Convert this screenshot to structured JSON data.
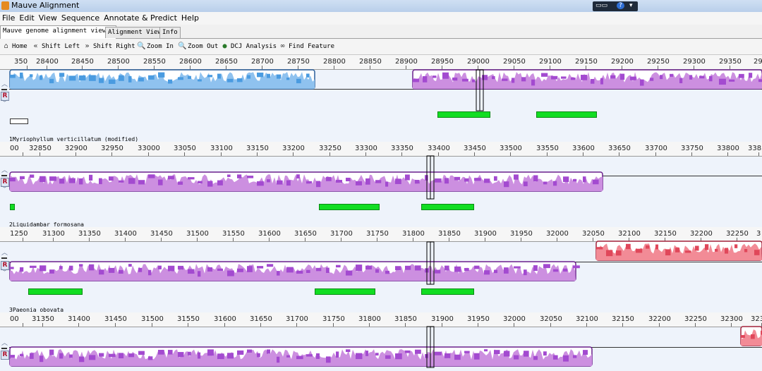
{
  "window": {
    "title": "Mauve Alignment"
  },
  "menu": [
    "File",
    "Edit",
    "View",
    "Sequence",
    "Annotate & Predict",
    "Help"
  ],
  "tabs": [
    "Mauve genome alignment viewer",
    "Alignment View",
    "Info"
  ],
  "active_tab": "Mauve genome alignment viewer",
  "toolbar": {
    "home": "Home",
    "shift_left": "Shift Left",
    "shift_right": "Shift Right",
    "zoom_in": "Zoom In",
    "zoom_out": "Zoom Out",
    "dcj": "DCJ Analysis",
    "find": "Find Feature"
  },
  "colors": {
    "blue_block": "#8fc2ef",
    "purple_block": "#cc8fe0",
    "red_block": "#f28b96",
    "feature": "#12dd22"
  },
  "genomes": [
    {
      "label": "",
      "ruler": [
        "350",
        "28400",
        "28450",
        "28500",
        "28550",
        "28600",
        "28650",
        "28700",
        "28750",
        "28800",
        "28850",
        "28900",
        "28950",
        "29000",
        "29050",
        "29100",
        "29150",
        "29200",
        "29250",
        "29300",
        "29350",
        "29"
      ]
    },
    {
      "label": "1Myriophyllum verticillatum (modified)",
      "ruler": [
        "00",
        "32850",
        "32900",
        "32950",
        "33000",
        "33050",
        "33100",
        "33150",
        "33200",
        "33250",
        "33300",
        "33350",
        "33400",
        "33450",
        "33500",
        "33550",
        "33600",
        "33650",
        "33700",
        "33750",
        "33800",
        "3385"
      ]
    },
    {
      "label": "2Liquidambar formosana",
      "ruler": [
        "1250",
        "31300",
        "31350",
        "31400",
        "31450",
        "31500",
        "31550",
        "31600",
        "31650",
        "31700",
        "31750",
        "31800",
        "31850",
        "31900",
        "31950",
        "32000",
        "32050",
        "32100",
        "32150",
        "32200",
        "32250",
        "3"
      ]
    },
    {
      "label": "3Paeonia obovata",
      "ruler": [
        "00",
        "31350",
        "31400",
        "31450",
        "31500",
        "31550",
        "31600",
        "31650",
        "31700",
        "31750",
        "31800",
        "31850",
        "31900",
        "31950",
        "32000",
        "32050",
        "32100",
        "32150",
        "32200",
        "32250",
        "32300",
        "323"
      ]
    }
  ]
}
